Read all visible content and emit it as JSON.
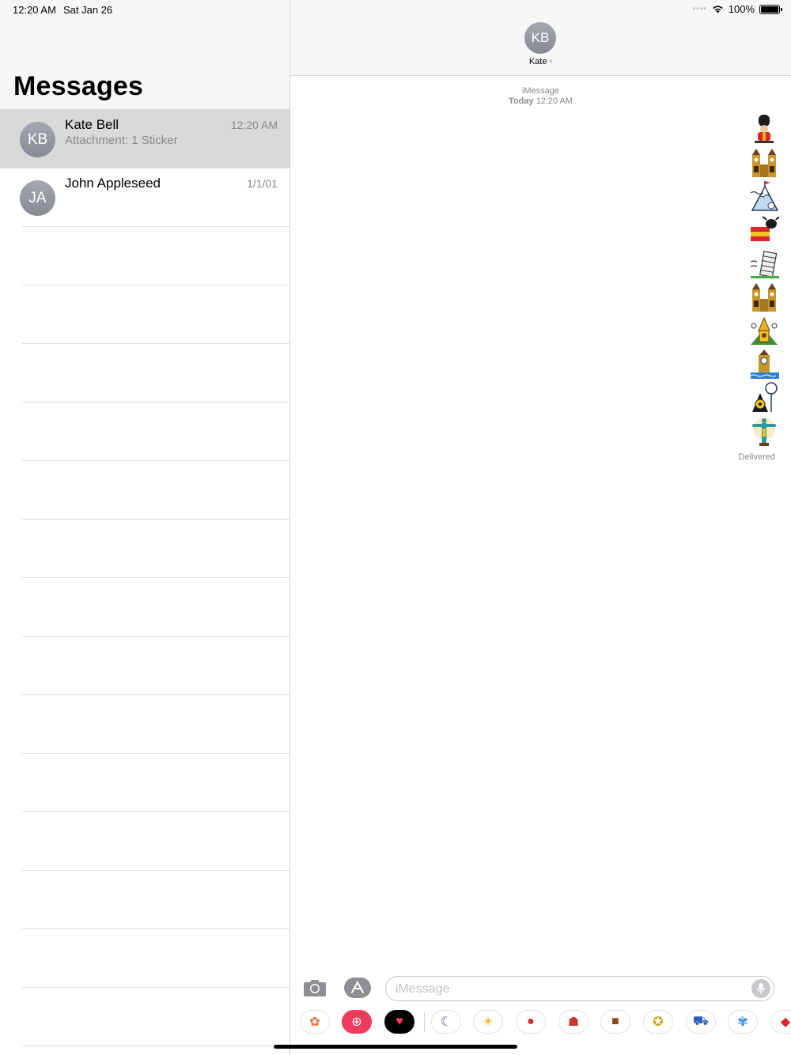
{
  "status_bar": {
    "time": "12:20 AM",
    "date": "Sat Jan 26",
    "battery": "100%",
    "battery_level": 1.0
  },
  "left_pane": {
    "title": "Messages",
    "conversations": [
      {
        "initials": "KB",
        "name": "Kate Bell",
        "preview": "Attachment: 1 Sticker",
        "time": "12:20 AM",
        "selected": true
      },
      {
        "initials": "JA",
        "name": "John Appleseed",
        "preview": "",
        "time": "1/1/01",
        "selected": false
      }
    ]
  },
  "conversation": {
    "contact_initials": "KB",
    "contact_name": "Kate",
    "service": "iMessage",
    "timestamp_day": "Today",
    "timestamp_time": "12:20 AM",
    "stickers": [
      "royal-guard-sticker",
      "big-ben-towers-sticker",
      "mountain-peak-sticker",
      "spain-bull-sticker",
      "leaning-tower-sticker",
      "big-ben-towers-sticker",
      "temple-sticker",
      "clock-tower-sticker",
      "eye-monument-sticker",
      "christ-statue-sticker"
    ],
    "status": "Delivered"
  },
  "compose": {
    "placeholder": "iMessage"
  },
  "app_strip": [
    {
      "name": "photos-app-icon",
      "glyph": "✿",
      "color": "#e86d3a"
    },
    {
      "name": "image-search-app-icon",
      "glyph": "⊕",
      "color": "#ffffff",
      "bg": "#ef3b5b"
    },
    {
      "name": "digital-touch-app-icon",
      "glyph": "♥",
      "color": "#ff3b6b",
      "bg": "#000000"
    },
    {
      "name": "night-sticker-app-icon",
      "glyph": "☾",
      "color": "#3b4aa0"
    },
    {
      "name": "weather-sticker-app-icon",
      "glyph": "☀",
      "color": "#e8b323"
    },
    {
      "name": "tomato-sticker-app-icon",
      "glyph": "●",
      "color": "#d8262c"
    },
    {
      "name": "person-sticker-app-icon",
      "glyph": "☗",
      "color": "#c0392b"
    },
    {
      "name": "suitcase-sticker-app-icon",
      "glyph": "■",
      "color": "#8b4a1c"
    },
    {
      "name": "medal-sticker-app-icon",
      "glyph": "✪",
      "color": "#d4a017"
    },
    {
      "name": "cart-sticker-app-icon",
      "glyph": "⛟",
      "color": "#2c5fb8"
    },
    {
      "name": "flower-sticker-app-icon",
      "glyph": "✾",
      "color": "#2f8fe0"
    },
    {
      "name": "map-sticker-app-icon",
      "glyph": "◆",
      "color": "#d8262c"
    }
  ]
}
